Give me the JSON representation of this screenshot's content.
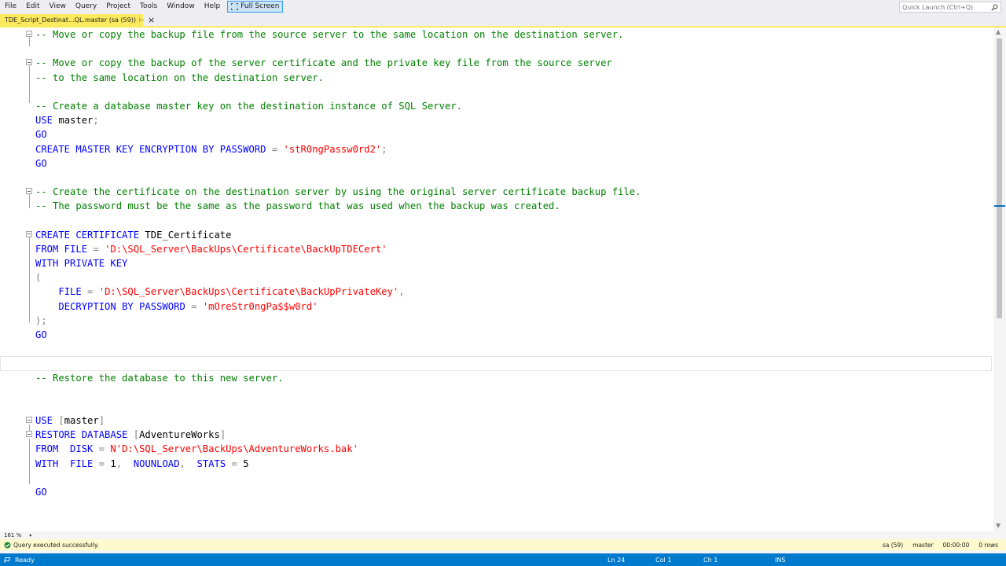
{
  "menu": [
    "File",
    "Edit",
    "View",
    "Query",
    "Project",
    "Tools",
    "Window",
    "Help"
  ],
  "fullscreen_label": "Full Screen",
  "quick_launch_placeholder": "Quick Launch (Ctrl+Q)",
  "tab": {
    "title": "TDE_Script_Destinat...QL.master (sa (59))",
    "pin": "⊢",
    "close": "×"
  },
  "code_lines": [
    {
      "fold": true,
      "segments": [
        {
          "c": "cm",
          "t": "-- Move or copy the backup file from the source server to the same location on the destination server."
        }
      ]
    },
    {
      "segments": []
    },
    {
      "fold": true,
      "segments": [
        {
          "c": "cm",
          "t": "-- Move or copy the backup of the server certificate and the private key file from the source server"
        }
      ]
    },
    {
      "segments": [
        {
          "c": "cm",
          "t": "-- to the same location on the destination server."
        }
      ]
    },
    {
      "segments": []
    },
    {
      "segments": [
        {
          "c": "cm",
          "t": "-- Create a database master key on the destination instance of SQL Server."
        }
      ]
    },
    {
      "segments": [
        {
          "c": "kw",
          "t": "USE "
        },
        {
          "c": "tx",
          "t": "master"
        },
        {
          "c": "gy",
          "t": ";"
        }
      ]
    },
    {
      "segments": [
        {
          "c": "kw",
          "t": "GO"
        }
      ]
    },
    {
      "segments": [
        {
          "c": "kw",
          "t": "CREATE MASTER KEY ENCRYPTION BY PASSWORD "
        },
        {
          "c": "gy",
          "t": "= "
        },
        {
          "c": "st",
          "t": "'stR0ngPassw0rd2'"
        },
        {
          "c": "gy",
          "t": ";"
        }
      ]
    },
    {
      "segments": [
        {
          "c": "kw",
          "t": "GO"
        }
      ]
    },
    {
      "segments": []
    },
    {
      "fold": true,
      "segments": [
        {
          "c": "cm",
          "t": "-- Create the certificate on the destination server by using the original server certificate backup file."
        }
      ]
    },
    {
      "segments": [
        {
          "c": "cm",
          "t": "-- The password must be the same as the password that was used when the backup was created."
        }
      ]
    },
    {
      "segments": []
    },
    {
      "fold": true,
      "segments": [
        {
          "c": "kw",
          "t": "CREATE CERTIFICATE "
        },
        {
          "c": "tx",
          "t": "TDE_Certificate"
        }
      ]
    },
    {
      "segments": [
        {
          "c": "kw",
          "t": "FROM FILE "
        },
        {
          "c": "gy",
          "t": "= "
        },
        {
          "c": "st",
          "t": "'D:\\SQL_Server\\BackUps\\Certificate\\BackUpTDECert'"
        }
      ]
    },
    {
      "segments": [
        {
          "c": "kw",
          "t": "WITH PRIVATE KEY"
        }
      ]
    },
    {
      "segments": [
        {
          "c": "gy",
          "t": "("
        }
      ]
    },
    {
      "segments": [
        {
          "c": "tx",
          "t": "    "
        },
        {
          "c": "kw",
          "t": "FILE "
        },
        {
          "c": "gy",
          "t": "= "
        },
        {
          "c": "st",
          "t": "'D:\\SQL_Server\\BackUps\\Certificate\\BackUpPrivateKey'"
        },
        {
          "c": "gy",
          "t": ","
        }
      ]
    },
    {
      "segments": [
        {
          "c": "tx",
          "t": "    "
        },
        {
          "c": "kw",
          "t": "DECRYPTION BY PASSWORD "
        },
        {
          "c": "gy",
          "t": "= "
        },
        {
          "c": "st",
          "t": "'mOreStr0ngPa$$w0rd'"
        }
      ]
    },
    {
      "segments": [
        {
          "c": "gy",
          "t": ");"
        }
      ]
    },
    {
      "segments": [
        {
          "c": "kw",
          "t": "GO"
        }
      ]
    },
    {
      "segments": []
    },
    {
      "current": true,
      "segments": []
    },
    {
      "segments": [
        {
          "c": "cm",
          "t": "-- Restore the database to this new server."
        }
      ]
    },
    {
      "segments": []
    },
    {
      "segments": []
    },
    {
      "fold": true,
      "segments": [
        {
          "c": "kw",
          "t": "USE "
        },
        {
          "c": "gy",
          "t": "["
        },
        {
          "c": "tx",
          "t": "master"
        },
        {
          "c": "gy",
          "t": "]"
        }
      ]
    },
    {
      "fold": true,
      "segments": [
        {
          "c": "kw",
          "t": "RESTORE DATABASE "
        },
        {
          "c": "gy",
          "t": "["
        },
        {
          "c": "tx",
          "t": "AdventureWorks"
        },
        {
          "c": "gy",
          "t": "]"
        }
      ]
    },
    {
      "segments": [
        {
          "c": "kw",
          "t": "FROM  DISK "
        },
        {
          "c": "gy",
          "t": "= "
        },
        {
          "c": "st",
          "t": "N'D:\\SQL_Server\\BackUps\\AdventureWorks.bak'"
        }
      ]
    },
    {
      "segments": [
        {
          "c": "kw",
          "t": "WITH  FILE "
        },
        {
          "c": "gy",
          "t": "= "
        },
        {
          "c": "tx",
          "t": "1"
        },
        {
          "c": "gy",
          "t": ",  "
        },
        {
          "c": "kw",
          "t": "NOUNLOAD"
        },
        {
          "c": "gy",
          "t": ",  "
        },
        {
          "c": "kw",
          "t": "STATS "
        },
        {
          "c": "gy",
          "t": "= "
        },
        {
          "c": "tx",
          "t": "5"
        }
      ]
    },
    {
      "segments": []
    },
    {
      "segments": [
        {
          "c": "kw",
          "t": "GO"
        }
      ]
    }
  ],
  "zoom": "161 %",
  "query_status": {
    "message": "Query executed successfully.",
    "login": "sa (59)",
    "database": "master",
    "elapsed": "00:00:00",
    "rows": "0 rows"
  },
  "status": {
    "ready": "Ready",
    "ln": "Ln 24",
    "col": "Col 1",
    "ch": "Ch 1",
    "mode": "INS"
  },
  "colors": {
    "accent": "#007acc",
    "tab": "#fbe95e",
    "comment": "#008000",
    "keyword": "#0000ff",
    "string": "#ff0000"
  }
}
